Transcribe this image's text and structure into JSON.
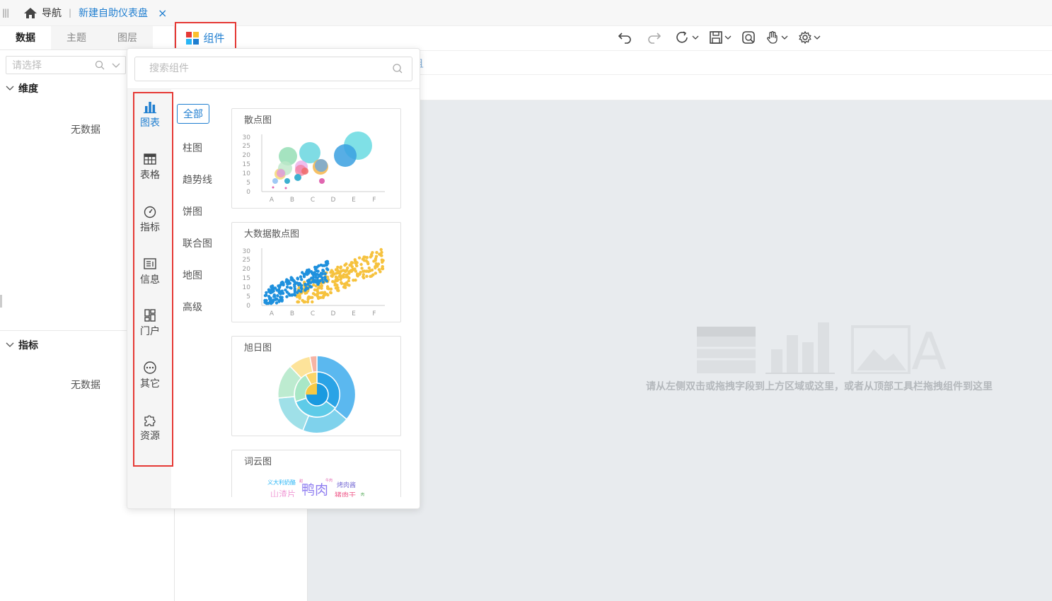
{
  "topbar": {
    "menu_icon": "|||",
    "home_label": "导航",
    "separator": "|",
    "tab_title": "新建自助仪表盘",
    "tab_close": "×"
  },
  "left_panel": {
    "tabs": [
      "数据",
      "主题",
      "图层"
    ],
    "active_tab": "数据",
    "select_placeholder": "请选择",
    "sections": [
      {
        "title": "维度",
        "empty_text": "无数据"
      },
      {
        "title": "指标",
        "empty_text": "无数据"
      }
    ]
  },
  "toolbar": {
    "components_label": "组件",
    "icons": [
      "undo-icon",
      "redo-icon",
      "refresh-icon",
      "save-icon",
      "preview-icon",
      "hand-icon",
      "settings-icon"
    ],
    "brand_colors": {
      "red": "#e53935",
      "blue": "#1f7ed0",
      "yellow": "#fbc02d",
      "green": "#43a047",
      "cyan": "#29b6f6"
    }
  },
  "filter_row": {
    "partial_text": "且"
  },
  "popover": {
    "search_placeholder": "搜索组件",
    "side_items": [
      {
        "label": "图表",
        "icon": "bar-chart-icon",
        "active": true
      },
      {
        "label": "表格",
        "icon": "table-icon"
      },
      {
        "label": "指标",
        "icon": "gauge-icon"
      },
      {
        "label": "信息",
        "icon": "info-icon"
      },
      {
        "label": "门户",
        "icon": "portal-icon"
      },
      {
        "label": "其它",
        "icon": "more-icon"
      },
      {
        "label": "资源",
        "icon": "puzzle-icon"
      }
    ],
    "categories": [
      "全部",
      "柱图",
      "趋势线",
      "饼图",
      "联合图",
      "地图",
      "高级"
    ],
    "active_category": "全部",
    "cards": [
      {
        "title": "散点图",
        "x_ticks": [
          "A",
          "B",
          "C",
          "D",
          "E",
          "F"
        ],
        "y_ticks": [
          "30",
          "25",
          "20",
          "15",
          "10",
          "5",
          "0"
        ]
      },
      {
        "title": "大数据散点图",
        "x_ticks": [
          "A",
          "B",
          "C",
          "D",
          "E",
          "F"
        ],
        "y_ticks": [
          "30",
          "25",
          "20",
          "15",
          "10",
          "5",
          "0"
        ]
      },
      {
        "title": "旭日图"
      },
      {
        "title": "词云图",
        "words": [
          "义大利奶酪",
          "鸭肉",
          "烤肉酱",
          "山渣片",
          "猪肉干",
          "甜",
          "牛肉",
          "肉"
        ]
      }
    ]
  },
  "canvas": {
    "hint": "请从左侧双击或拖拽字段到上方区域或这里，或者从顶部工具栏拖拽组件到这里"
  }
}
